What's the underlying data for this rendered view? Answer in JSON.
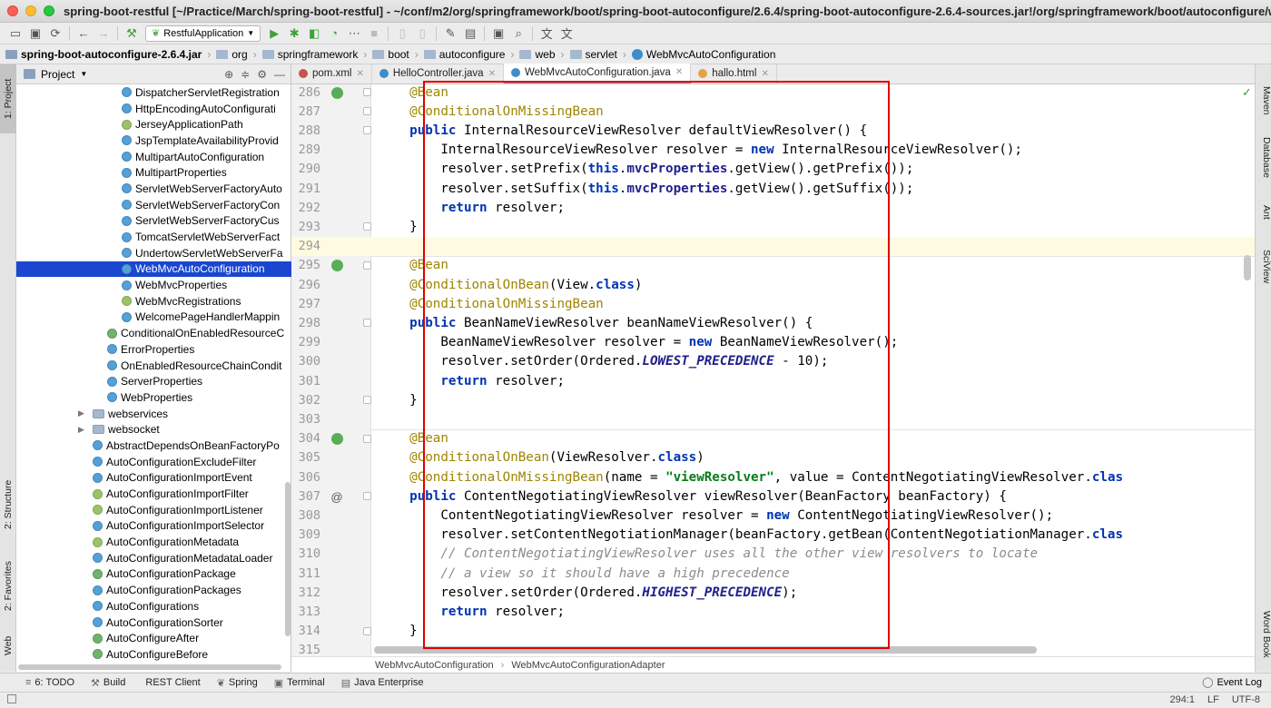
{
  "window": {
    "title": "spring-boot-restful [~/Practice/March/spring-boot-restful] - ~/conf/m2/org/springframework/boot/spring-boot-autoconfigure/2.6.4/spring-boot-autoconfigure-2.6.4-sources.jar!/org/springframework/boot/autoconfigure/web/serv..."
  },
  "toolbar": {
    "run_config": "RestfulApplication"
  },
  "breadcrumb": [
    "spring-boot-autoconfigure-2.6.4.jar",
    "org",
    "springframework",
    "boot",
    "autoconfigure",
    "web",
    "servlet",
    "WebMvcAutoConfiguration"
  ],
  "left_tabs": {
    "project": "1: Project",
    "structure": "2: Structure",
    "favorites": "2: Favorites",
    "web": "Web"
  },
  "right_tabs": {
    "maven": "Maven",
    "database": "Database",
    "ant": "Ant",
    "sciview": "SciView",
    "wordbook": "Word Book"
  },
  "project_panel": {
    "title": "Project",
    "items": [
      {
        "label": "DispatcherServletRegistration",
        "icon": "class",
        "indent": 3
      },
      {
        "label": "HttpEncodingAutoConfigurati",
        "icon": "class",
        "indent": 3
      },
      {
        "label": "JerseyApplicationPath",
        "icon": "interface",
        "indent": 3
      },
      {
        "label": "JspTemplateAvailabilityProvid",
        "icon": "class",
        "indent": 3
      },
      {
        "label": "MultipartAutoConfiguration",
        "icon": "class",
        "indent": 3
      },
      {
        "label": "MultipartProperties",
        "icon": "class",
        "indent": 3
      },
      {
        "label": "ServletWebServerFactoryAuto",
        "icon": "class",
        "indent": 3
      },
      {
        "label": "ServletWebServerFactoryCon",
        "icon": "class",
        "indent": 3
      },
      {
        "label": "ServletWebServerFactoryCus",
        "icon": "class",
        "indent": 3
      },
      {
        "label": "TomcatServletWebServerFact",
        "icon": "class",
        "indent": 3
      },
      {
        "label": "UndertowServletWebServerFa",
        "icon": "class",
        "indent": 3
      },
      {
        "label": "WebMvcAutoConfiguration",
        "icon": "class",
        "indent": 3,
        "selected": true
      },
      {
        "label": "WebMvcProperties",
        "icon": "class",
        "indent": 3
      },
      {
        "label": "WebMvcRegistrations",
        "icon": "interface",
        "indent": 3
      },
      {
        "label": "WelcomePageHandlerMappin",
        "icon": "class",
        "indent": 3
      },
      {
        "label": "ConditionalOnEnabledResourceC",
        "icon": "annotation",
        "indent": 2
      },
      {
        "label": "ErrorProperties",
        "icon": "class",
        "indent": 2
      },
      {
        "label": "OnEnabledResourceChainCondit",
        "icon": "class",
        "indent": 2
      },
      {
        "label": "ServerProperties",
        "icon": "class",
        "indent": 2
      },
      {
        "label": "WebProperties",
        "icon": "class",
        "indent": 2
      },
      {
        "label": "webservices",
        "icon": "folder",
        "indent": 1,
        "arrow": "▶"
      },
      {
        "label": "websocket",
        "icon": "folder",
        "indent": 1,
        "arrow": "▶"
      },
      {
        "label": "AbstractDependsOnBeanFactoryPo",
        "icon": "class",
        "indent": 1
      },
      {
        "label": "AutoConfigurationExcludeFilter",
        "icon": "class",
        "indent": 1
      },
      {
        "label": "AutoConfigurationImportEvent",
        "icon": "class",
        "indent": 1
      },
      {
        "label": "AutoConfigurationImportFilter",
        "icon": "interface",
        "indent": 1
      },
      {
        "label": "AutoConfigurationImportListener",
        "icon": "interface",
        "indent": 1
      },
      {
        "label": "AutoConfigurationImportSelector",
        "icon": "class",
        "indent": 1
      },
      {
        "label": "AutoConfigurationMetadata",
        "icon": "interface",
        "indent": 1
      },
      {
        "label": "AutoConfigurationMetadataLoader",
        "icon": "class",
        "indent": 1
      },
      {
        "label": "AutoConfigurationPackage",
        "icon": "annotation",
        "indent": 1
      },
      {
        "label": "AutoConfigurationPackages",
        "icon": "class",
        "indent": 1
      },
      {
        "label": "AutoConfigurations",
        "icon": "class",
        "indent": 1
      },
      {
        "label": "AutoConfigurationSorter",
        "icon": "class",
        "indent": 1
      },
      {
        "label": "AutoConfigureAfter",
        "icon": "annotation",
        "indent": 1
      },
      {
        "label": "AutoConfigureBefore",
        "icon": "annotation",
        "indent": 1
      }
    ]
  },
  "tabs": [
    {
      "label": "pom.xml",
      "icon": "maven"
    },
    {
      "label": "HelloController.java",
      "icon": "class"
    },
    {
      "label": "WebMvcAutoConfiguration.java",
      "icon": "class",
      "active": true
    },
    {
      "label": "hallo.html",
      "icon": "html"
    }
  ],
  "editor": {
    "current_line": 294,
    "lines": [
      {
        "n": "286",
        "m": "bean",
        "t": [
          [
            "ann",
            "    @Bean"
          ]
        ]
      },
      {
        "n": "287",
        "t": [
          [
            "ann",
            "    @ConditionalOnMissingBean"
          ]
        ]
      },
      {
        "n": "288",
        "t": [
          [
            "kw",
            "    public "
          ],
          [
            "",
            "InternalResourceViewResolver defaultViewResolver() {"
          ]
        ]
      },
      {
        "n": "289",
        "t": [
          [
            "",
            "        InternalResourceViewResolver resolver = "
          ],
          [
            "kw",
            "new "
          ],
          [
            "",
            "InternalResourceViewResolver();"
          ]
        ]
      },
      {
        "n": "290",
        "t": [
          [
            "",
            "        resolver.setPrefix("
          ],
          [
            "kw",
            "this"
          ],
          [
            "",
            "."
          ],
          [
            "fld",
            "mvcProperties"
          ],
          [
            "",
            ".getView().getPrefix());"
          ]
        ]
      },
      {
        "n": "291",
        "t": [
          [
            "",
            "        resolver.setSuffix("
          ],
          [
            "kw",
            "this"
          ],
          [
            "",
            "."
          ],
          [
            "fld",
            "mvcProperties"
          ],
          [
            "",
            ".getView().getSuffix());"
          ]
        ]
      },
      {
        "n": "292",
        "t": [
          [
            "kw",
            "        return "
          ],
          [
            "",
            "resolver;"
          ]
        ]
      },
      {
        "n": "293",
        "t": [
          [
            "",
            "    }"
          ]
        ]
      },
      {
        "n": "294",
        "t": [
          [
            "",
            ""
          ]
        ]
      },
      {
        "n": "295",
        "m": "bean",
        "t": [
          [
            "ann",
            "    @Bean"
          ]
        ]
      },
      {
        "n": "296",
        "t": [
          [
            "ann",
            "    @ConditionalOnBean"
          ],
          [
            "",
            "(View."
          ],
          [
            "kw",
            "class"
          ],
          [
            "",
            ")"
          ]
        ]
      },
      {
        "n": "297",
        "t": [
          [
            "ann",
            "    @ConditionalOnMissingBean"
          ]
        ]
      },
      {
        "n": "298",
        "t": [
          [
            "kw",
            "    public "
          ],
          [
            "",
            "BeanNameViewResolver beanNameViewResolver() {"
          ]
        ]
      },
      {
        "n": "299",
        "t": [
          [
            "",
            "        BeanNameViewResolver resolver = "
          ],
          [
            "kw",
            "new "
          ],
          [
            "",
            "BeanNameViewResolver();"
          ]
        ]
      },
      {
        "n": "300",
        "t": [
          [
            "",
            "        resolver.setOrder(Ordered."
          ],
          [
            "cst",
            "LOWEST_PRECEDENCE"
          ],
          [
            "",
            " - 10);"
          ]
        ]
      },
      {
        "n": "301",
        "t": [
          [
            "kw",
            "        return "
          ],
          [
            "",
            "resolver;"
          ]
        ]
      },
      {
        "n": "302",
        "t": [
          [
            "",
            "    }"
          ]
        ]
      },
      {
        "n": "303",
        "t": [
          [
            "",
            ""
          ]
        ]
      },
      {
        "n": "304",
        "m": "bean",
        "t": [
          [
            "ann",
            "    @Bean"
          ]
        ]
      },
      {
        "n": "305",
        "t": [
          [
            "ann",
            "    @ConditionalOnBean"
          ],
          [
            "",
            "(ViewResolver."
          ],
          [
            "kw",
            "class"
          ],
          [
            "",
            ")"
          ]
        ]
      },
      {
        "n": "306",
        "t": [
          [
            "ann",
            "    @ConditionalOnMissingBean"
          ],
          [
            "",
            "(name = "
          ],
          [
            "str",
            "\"viewResolver\""
          ],
          [
            "",
            ", value = ContentNegotiatingViewResolver."
          ],
          [
            "kw",
            "clas"
          ]
        ]
      },
      {
        "n": "307",
        "m": "at",
        "t": [
          [
            "kw",
            "    public "
          ],
          [
            "",
            "ContentNegotiatingViewResolver viewResolver(BeanFactory beanFactory) {"
          ]
        ]
      },
      {
        "n": "308",
        "t": [
          [
            "",
            "        ContentNegotiatingViewResolver resolver = "
          ],
          [
            "kw",
            "new "
          ],
          [
            "",
            "ContentNegotiatingViewResolver();"
          ]
        ]
      },
      {
        "n": "309",
        "t": [
          [
            "",
            "        resolver.setContentNegotiationManager(beanFactory.getBean(ContentNegotiationManager."
          ],
          [
            "kw",
            "clas"
          ]
        ]
      },
      {
        "n": "310",
        "t": [
          [
            "cmt",
            "        // ContentNegotiatingViewResolver uses all the other view resolvers to locate"
          ]
        ]
      },
      {
        "n": "311",
        "t": [
          [
            "cmt",
            "        // a view so it should have a high precedence"
          ]
        ]
      },
      {
        "n": "312",
        "t": [
          [
            "",
            "        resolver.setOrder(Ordered."
          ],
          [
            "cst",
            "HIGHEST_PRECEDENCE"
          ],
          [
            "",
            ");"
          ]
        ]
      },
      {
        "n": "313",
        "t": [
          [
            "kw",
            "        return "
          ],
          [
            "",
            "resolver;"
          ]
        ]
      },
      {
        "n": "314",
        "t": [
          [
            "",
            "    }"
          ]
        ]
      },
      {
        "n": "315",
        "t": [
          [
            "",
            ""
          ]
        ]
      }
    ]
  },
  "editor_breadcrumb": [
    "WebMvcAutoConfiguration",
    "WebMvcAutoConfigurationAdapter"
  ],
  "bottom_tools": [
    {
      "label": "6: TODO",
      "icon": "≡"
    },
    {
      "label": "Build",
      "icon": "⚒"
    },
    {
      "label": "REST Client",
      "icon": ""
    },
    {
      "label": "Spring",
      "icon": "❦"
    },
    {
      "label": "Terminal",
      "icon": "▣"
    },
    {
      "label": "Java Enterprise",
      "icon": "▤"
    }
  ],
  "event_log": "Event Log",
  "status": {
    "position": "294:1",
    "line_sep": "LF",
    "encoding": "UTF-8"
  },
  "colors": {
    "annotation": "#9e8500",
    "keyword": "#0033b3",
    "field": "#20208a",
    "string": "#067d17",
    "comment": "#8c8c8c",
    "selection": "#1a46d0",
    "highlight_box": "#e00000"
  }
}
